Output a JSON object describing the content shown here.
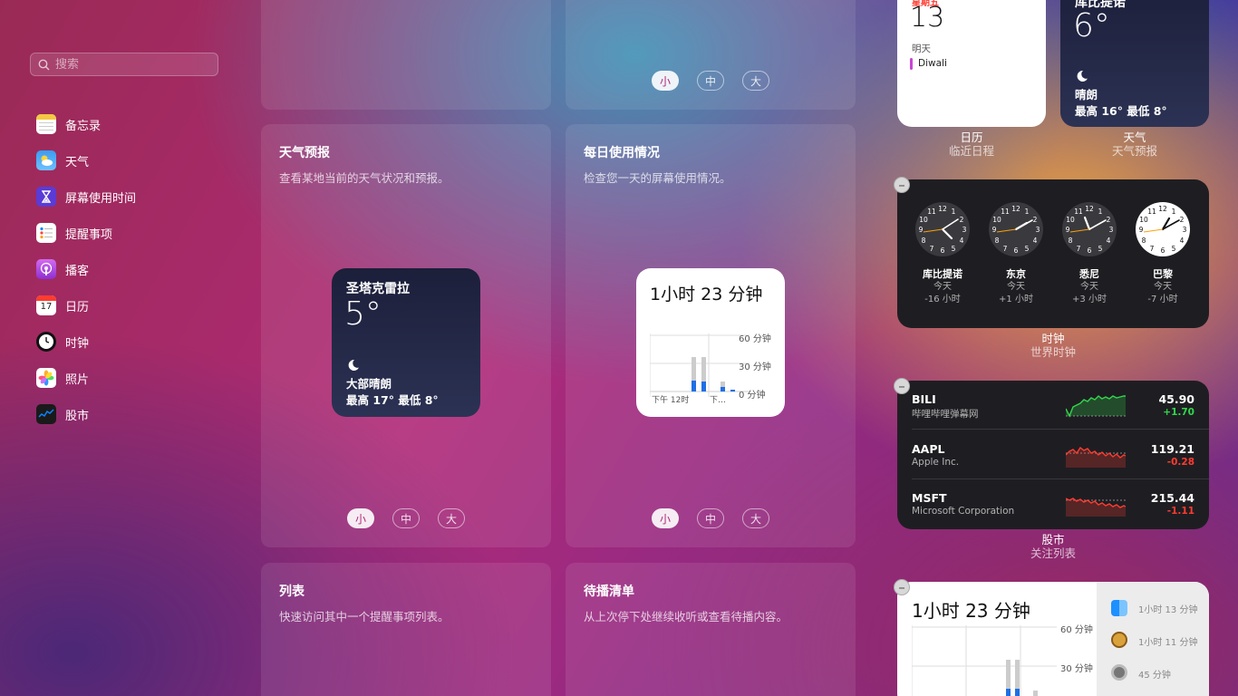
{
  "sidebar": {
    "search": {
      "placeholder": "搜索"
    },
    "items": [
      {
        "label": "备忘录",
        "icon": "notes-icon",
        "color": "#f5c842"
      },
      {
        "label": "天气",
        "icon": "weather-icon",
        "color": "#3b9cf0"
      },
      {
        "label": "屏幕使用时间",
        "icon": "screen-time-icon",
        "color": "#5b3bd6"
      },
      {
        "label": "提醒事项",
        "icon": "reminders-icon",
        "color": "#ffffff"
      },
      {
        "label": "播客",
        "icon": "podcasts-icon",
        "color": "#b14de0"
      },
      {
        "label": "日历",
        "icon": "calendar-icon",
        "color": "#ffffff"
      },
      {
        "label": "时钟",
        "icon": "clock-icon",
        "color": "#111111"
      },
      {
        "label": "照片",
        "icon": "photos-icon",
        "color": "#ffffff"
      },
      {
        "label": "股市",
        "icon": "stocks-icon",
        "color": "#1a1a1a"
      }
    ]
  },
  "sizes": {
    "small": "小",
    "medium": "中",
    "large": "大"
  },
  "gallery": {
    "weather": {
      "title": "天气预报",
      "desc": "查看某地当前的天气状况和预报。",
      "preview": {
        "city": "圣塔克雷拉",
        "temp": "5°",
        "condition": "大部晴朗",
        "range": "最高 17° 最低 8°"
      }
    },
    "screentime": {
      "title": "每日使用情况",
      "desc": "检查您一天的屏幕使用情况。",
      "preview": {
        "total": "1小时 23 分钟",
        "y60": "60 分钟",
        "y30": "30 分钟",
        "y0": "0 分钟",
        "x1": "下午 12时",
        "x2": "下…"
      }
    },
    "reminders": {
      "title": "列表",
      "desc": "快速访问其中一个提醒事项列表。"
    },
    "podcasts": {
      "title": "待播清单",
      "desc": "从上次停下处继续收听或查看待播内容。"
    }
  },
  "widgets": {
    "calendar": {
      "weekday": "星期五",
      "day": "13",
      "tomorrow": "明天",
      "event": "Diwali",
      "event_color": "#c845d6",
      "name": "日历",
      "subtitle": "临近日程"
    },
    "weather": {
      "city": "库比提诺",
      "temp": "6°",
      "condition": "晴朗",
      "range": "最高 16° 最低 8°",
      "name": "天气",
      "subtitle": "天气预报"
    },
    "clock": {
      "name": "时钟",
      "subtitle": "世界时钟",
      "cities": [
        {
          "city": "库比提诺",
          "day": "今天",
          "offset": "-16 小时"
        },
        {
          "city": "东京",
          "day": "今天",
          "offset": "+1 小时"
        },
        {
          "city": "悉尼",
          "day": "今天",
          "offset": "+3 小时"
        },
        {
          "city": "巴黎",
          "day": "今天",
          "offset": "-7 小时"
        }
      ]
    },
    "stocks": {
      "name": "股市",
      "subtitle": "关注列表",
      "rows": [
        {
          "symbol": "BILI",
          "company": "哔哩哔哩弹幕网",
          "price": "45.90",
          "change": "+1.70",
          "trend": "up",
          "color": "#32d74b"
        },
        {
          "symbol": "AAPL",
          "company": "Apple Inc.",
          "price": "119.21",
          "change": "-0.28",
          "trend": "down",
          "color": "#ff3b30"
        },
        {
          "symbol": "MSFT",
          "company": "Microsoft Corporation",
          "price": "215.44",
          "change": "-1.11",
          "trend": "down",
          "color": "#ff3b30"
        }
      ]
    },
    "screentime": {
      "total": "1小时 23 分钟",
      "y60": "60 分钟",
      "y30": "30 分钟",
      "apps": [
        {
          "time": "1小时 13 分钟",
          "icon": "finder-icon"
        },
        {
          "time": "1小时 11 分钟",
          "icon": "acorn-icon"
        },
        {
          "time": "45 分钟",
          "icon": "system-preferences-icon"
        }
      ]
    }
  }
}
